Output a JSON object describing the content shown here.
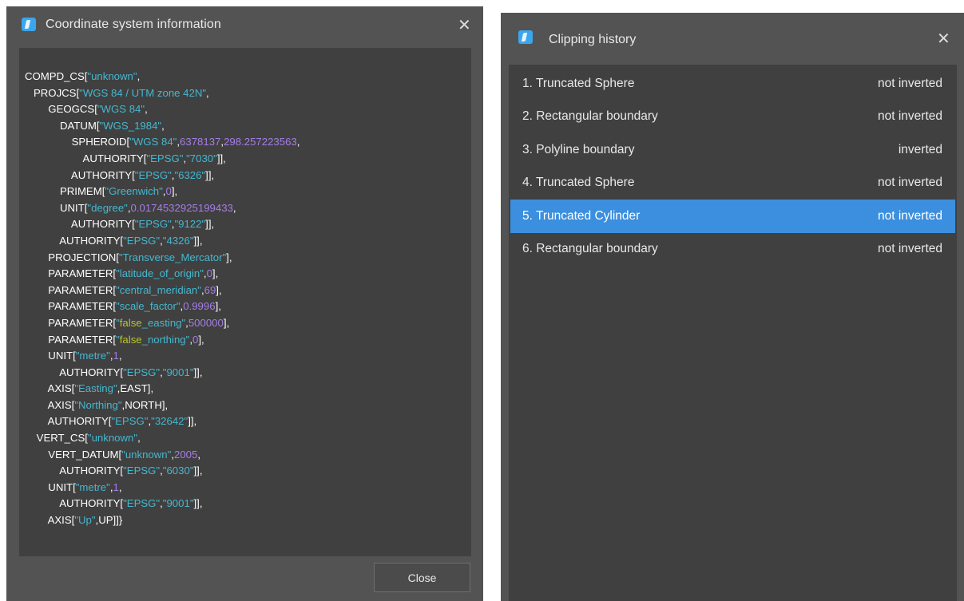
{
  "coordinate_dialog": {
    "title": "Coordinate system information",
    "close_button_label": "Close",
    "lines": [
      [
        {
          "t": "t",
          "v": "COMPD_CS["
        },
        {
          "t": "s",
          "v": "\"unknown\""
        },
        {
          "t": "t",
          "v": ","
        }
      ],
      [
        {
          "t": "t",
          "v": "   PROJCS["
        },
        {
          "t": "s",
          "v": "\"WGS 84 / UTM zone 42N\""
        },
        {
          "t": "t",
          "v": ","
        }
      ],
      [
        {
          "t": "t",
          "v": "        GEOGCS["
        },
        {
          "t": "s",
          "v": "\"WGS 84\""
        },
        {
          "t": "t",
          "v": ","
        }
      ],
      [
        {
          "t": "t",
          "v": "            DATUM["
        },
        {
          "t": "s",
          "v": "\"WGS_1984\""
        },
        {
          "t": "t",
          "v": ","
        }
      ],
      [
        {
          "t": "t",
          "v": "                SPHEROID["
        },
        {
          "t": "s",
          "v": "\"WGS 84\""
        },
        {
          "t": "t",
          "v": ","
        },
        {
          "t": "n",
          "v": "6378137"
        },
        {
          "t": "t",
          "v": ","
        },
        {
          "t": "n",
          "v": "298.257223563"
        },
        {
          "t": "t",
          "v": ","
        }
      ],
      [
        {
          "t": "t",
          "v": "                    AUTHORITY["
        },
        {
          "t": "s",
          "v": "\"EPSG\""
        },
        {
          "t": "t",
          "v": ","
        },
        {
          "t": "s",
          "v": "\"7030\""
        },
        {
          "t": "t",
          "v": "]],"
        }
      ],
      [
        {
          "t": "t",
          "v": "                AUTHORITY["
        },
        {
          "t": "s",
          "v": "\"EPSG\""
        },
        {
          "t": "t",
          "v": ","
        },
        {
          "t": "s",
          "v": "\"6326\""
        },
        {
          "t": "t",
          "v": "]],"
        }
      ],
      [
        {
          "t": "t",
          "v": "            PRIMEM["
        },
        {
          "t": "s",
          "v": "\"Greenwich\""
        },
        {
          "t": "t",
          "v": ","
        },
        {
          "t": "n",
          "v": "0"
        },
        {
          "t": "t",
          "v": "],"
        }
      ],
      [
        {
          "t": "t",
          "v": "            UNIT["
        },
        {
          "t": "s",
          "v": "\"degree\""
        },
        {
          "t": "t",
          "v": ","
        },
        {
          "t": "n",
          "v": "0.0174532925199433"
        },
        {
          "t": "t",
          "v": ","
        }
      ],
      [
        {
          "t": "t",
          "v": "                AUTHORITY["
        },
        {
          "t": "s",
          "v": "\"EPSG\""
        },
        {
          "t": "t",
          "v": ","
        },
        {
          "t": "s",
          "v": "\"9122\""
        },
        {
          "t": "t",
          "v": "]],"
        }
      ],
      [
        {
          "t": "t",
          "v": "            AUTHORITY["
        },
        {
          "t": "s",
          "v": "\"EPSG\""
        },
        {
          "t": "t",
          "v": ","
        },
        {
          "t": "s",
          "v": "\"4326\""
        },
        {
          "t": "t",
          "v": "]],"
        }
      ],
      [
        {
          "t": "t",
          "v": "        PROJECTION["
        },
        {
          "t": "s",
          "v": "\"Transverse_Mercator\""
        },
        {
          "t": "t",
          "v": "],"
        }
      ],
      [
        {
          "t": "t",
          "v": "        PARAMETER["
        },
        {
          "t": "s",
          "v": "\"latitude_of_origin\""
        },
        {
          "t": "t",
          "v": ","
        },
        {
          "t": "n",
          "v": "0"
        },
        {
          "t": "t",
          "v": "],"
        }
      ],
      [
        {
          "t": "t",
          "v": "        PARAMETER["
        },
        {
          "t": "s",
          "v": "\"central_meridian\""
        },
        {
          "t": "t",
          "v": ","
        },
        {
          "t": "n",
          "v": "69"
        },
        {
          "t": "t",
          "v": "],"
        }
      ],
      [
        {
          "t": "t",
          "v": "        PARAMETER["
        },
        {
          "t": "s",
          "v": "\"scale_factor\""
        },
        {
          "t": "t",
          "v": ","
        },
        {
          "t": "n",
          "v": "0.9996"
        },
        {
          "t": "t",
          "v": "],"
        }
      ],
      [
        {
          "t": "t",
          "v": "        PARAMETER["
        },
        {
          "t": "s",
          "v": "\""
        },
        {
          "t": "y",
          "v": "false"
        },
        {
          "t": "s",
          "v": "_easting\""
        },
        {
          "t": "t",
          "v": ","
        },
        {
          "t": "n",
          "v": "500000"
        },
        {
          "t": "t",
          "v": "],"
        }
      ],
      [
        {
          "t": "t",
          "v": "        PARAMETER["
        },
        {
          "t": "s",
          "v": "\""
        },
        {
          "t": "y",
          "v": "false"
        },
        {
          "t": "s",
          "v": "_northing\""
        },
        {
          "t": "t",
          "v": ","
        },
        {
          "t": "n",
          "v": "0"
        },
        {
          "t": "t",
          "v": "],"
        }
      ],
      [
        {
          "t": "t",
          "v": "        UNIT["
        },
        {
          "t": "s",
          "v": "\"metre\""
        },
        {
          "t": "t",
          "v": ","
        },
        {
          "t": "n",
          "v": "1"
        },
        {
          "t": "t",
          "v": ","
        }
      ],
      [
        {
          "t": "t",
          "v": "            AUTHORITY["
        },
        {
          "t": "s",
          "v": "\"EPSG\""
        },
        {
          "t": "t",
          "v": ","
        },
        {
          "t": "s",
          "v": "\"9001\""
        },
        {
          "t": "t",
          "v": "]],"
        }
      ],
      [
        {
          "t": "t",
          "v": "        AXIS["
        },
        {
          "t": "s",
          "v": "\"Easting\""
        },
        {
          "t": "t",
          "v": ",EAST],"
        }
      ],
      [
        {
          "t": "t",
          "v": "        AXIS["
        },
        {
          "t": "s",
          "v": "\"Northing\""
        },
        {
          "t": "t",
          "v": ",NORTH],"
        }
      ],
      [
        {
          "t": "t",
          "v": "        AUTHORITY["
        },
        {
          "t": "s",
          "v": "\"EPSG\""
        },
        {
          "t": "t",
          "v": ","
        },
        {
          "t": "s",
          "v": "\"32642\""
        },
        {
          "t": "t",
          "v": "]],"
        }
      ],
      [
        {
          "t": "t",
          "v": "    VERT_CS["
        },
        {
          "t": "s",
          "v": "\"unknown\""
        },
        {
          "t": "t",
          "v": ","
        }
      ],
      [
        {
          "t": "t",
          "v": "        VERT_DATUM["
        },
        {
          "t": "s",
          "v": "\"unknown\""
        },
        {
          "t": "t",
          "v": ","
        },
        {
          "t": "n",
          "v": "2005"
        },
        {
          "t": "t",
          "v": ","
        }
      ],
      [
        {
          "t": "t",
          "v": "            AUTHORITY["
        },
        {
          "t": "s",
          "v": "\"EPSG\""
        },
        {
          "t": "t",
          "v": ","
        },
        {
          "t": "s",
          "v": "\"6030\""
        },
        {
          "t": "t",
          "v": "]],"
        }
      ],
      [
        {
          "t": "t",
          "v": "        UNIT["
        },
        {
          "t": "s",
          "v": "\"metre\""
        },
        {
          "t": "t",
          "v": ","
        },
        {
          "t": "n",
          "v": "1"
        },
        {
          "t": "t",
          "v": ","
        }
      ],
      [
        {
          "t": "t",
          "v": "            AUTHORITY["
        },
        {
          "t": "s",
          "v": "\"EPSG\""
        },
        {
          "t": "t",
          "v": ","
        },
        {
          "t": "s",
          "v": "\"9001\""
        },
        {
          "t": "t",
          "v": "]],"
        }
      ],
      [
        {
          "t": "t",
          "v": "        AXIS["
        },
        {
          "t": "s",
          "v": "\"Up\""
        },
        {
          "t": "t",
          "v": ",UP]]}"
        }
      ]
    ]
  },
  "clipping_dialog": {
    "title": "Clipping history",
    "items": [
      {
        "label": "1. Truncated Sphere",
        "status": "not inverted",
        "selected": false
      },
      {
        "label": "2. Rectangular boundary",
        "status": "not inverted",
        "selected": false
      },
      {
        "label": "3. Polyline boundary",
        "status": "inverted",
        "selected": false
      },
      {
        "label": "4. Truncated Sphere",
        "status": "not inverted",
        "selected": false
      },
      {
        "label": "5. Truncated Cylinder",
        "status": "not inverted",
        "selected": true
      },
      {
        "label": "6. Rectangular boundary",
        "status": "not inverted",
        "selected": false
      }
    ]
  },
  "icons": {
    "app_icon": "app-logo-icon",
    "close": "close-icon"
  },
  "colors": {
    "dialog_bg": "#535353",
    "panel_bg": "#404040",
    "selection": "#3b8fde",
    "string_token": "#45b7cf",
    "number_token": "#a57de6",
    "keyword_token": "#b8c42e"
  }
}
